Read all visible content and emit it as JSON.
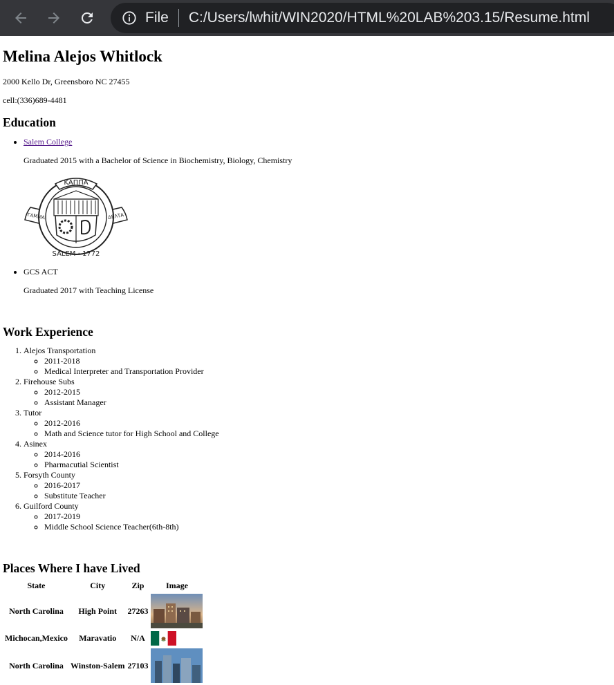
{
  "browser": {
    "url_scheme_label": "File",
    "url": "C:/Users/lwhit/WIN2020/HTML%20LAB%203.15/Resume.html"
  },
  "resume": {
    "name": "Melina Alejos Whitlock",
    "address": "2000 Kello Dr, Greensboro NC 27455",
    "cell": "cell:(336)689-4481",
    "education": {
      "heading": "Education",
      "items": [
        {
          "school": "Salem College",
          "is_link": true,
          "description": "Graduated 2015 with a Bachelor of Science in Biochemistry, Biology, Chemistry"
        },
        {
          "school": "GCS ACT",
          "is_link": false,
          "description": "Graduated 2017 with Teaching License"
        }
      ],
      "seal": {
        "top_text": "ΚΑΠΠΑ",
        "left_text": "ΓΑΜΜΑ",
        "right_text": "ΔΕΛΤΑ",
        "bottom_text": "SALEM · 1772"
      }
    },
    "work": {
      "heading": "Work Experience",
      "jobs": [
        {
          "employer": "Alejos Transportation",
          "years": "2011-2018",
          "role": "Medical Interpreter and Transportation Provider"
        },
        {
          "employer": "Firehouse Subs",
          "years": "2012-2015",
          "role": "Assistant Manager"
        },
        {
          "employer": "Tutor",
          "years": "2012-2016",
          "role": "Math and Science tutor for High School and College"
        },
        {
          "employer": "Asinex",
          "years": "2014-2016",
          "role": "Pharmacutial Scientist"
        },
        {
          "employer": "Forsyth County",
          "years": "2016-2017",
          "role": "Substitute Teacher"
        },
        {
          "employer": "Guilford County",
          "years": "2017-2019",
          "role": "Middle School Science Teacher(6th-8th)"
        }
      ]
    },
    "places": {
      "heading": "Places Where I have Lived",
      "columns": [
        "State",
        "City",
        "Zip",
        "Image"
      ],
      "rows": [
        {
          "state": "North Carolina",
          "city": "High Point",
          "zip": "27263",
          "image": "city-skyline-photo"
        },
        {
          "state": "Michocan,Mexico",
          "city": "Maravatio",
          "zip": "N/A",
          "image": "mexico-flag"
        },
        {
          "state": "North Carolina",
          "city": "Winston-Salem",
          "zip": "27103",
          "image": "city-skyline-photo"
        }
      ]
    }
  },
  "colors": {
    "chrome_bg": "#35363a",
    "omnibox_bg": "#202124",
    "visited_link": "#551a8b"
  }
}
